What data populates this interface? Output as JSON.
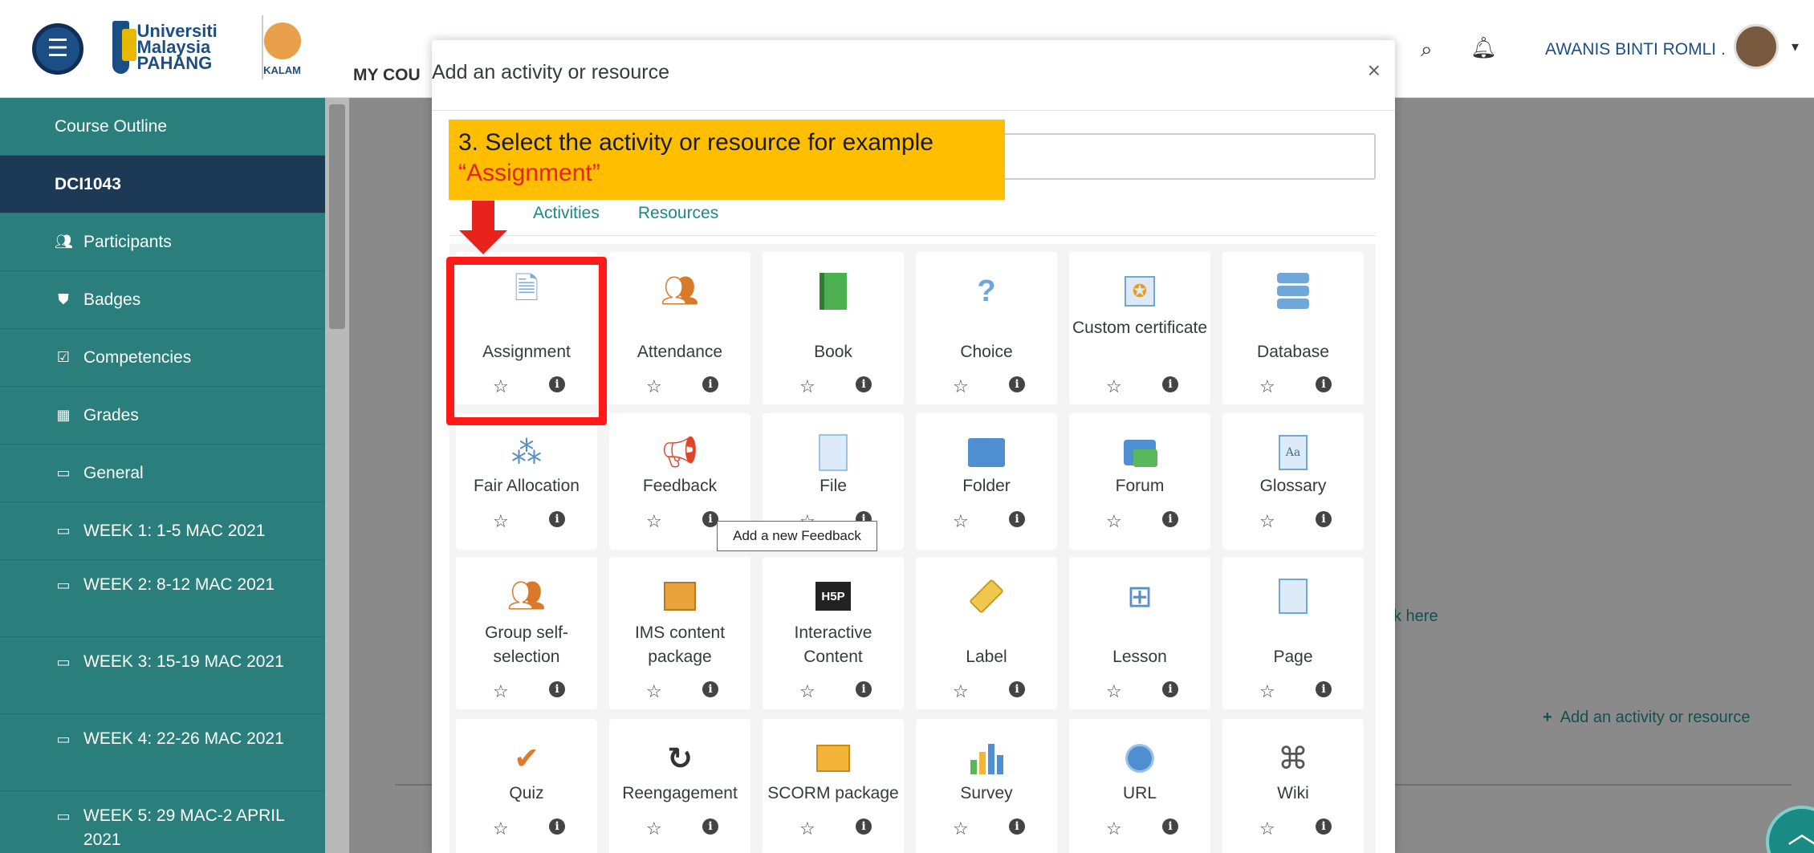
{
  "header": {
    "logo": {
      "text": "Universiti Malaysia PAHANG",
      "kalam": "KALAM"
    },
    "nav_label": "MY COU",
    "user_name": "AWANIS BINTI ROMLI .",
    "icons": [
      "menu-icon",
      "search-icon",
      "bell-icon",
      "chevron-down-icon"
    ]
  },
  "sidebar": {
    "items": [
      {
        "label": "Course Outline",
        "icon": ""
      },
      {
        "label": "DCI1043",
        "icon": "",
        "active": true
      },
      {
        "label": "Participants",
        "icon": "users-icon"
      },
      {
        "label": "Badges",
        "icon": "shield-icon"
      },
      {
        "label": "Competencies",
        "icon": "check-square-icon"
      },
      {
        "label": "Grades",
        "icon": "table-icon"
      },
      {
        "label": "General",
        "icon": "folder-icon"
      },
      {
        "label": "WEEK 1: 1-5 MAC 2021",
        "icon": "folder-icon"
      },
      {
        "label": "WEEK 2: 8-12 MAC 2021",
        "icon": "folder-icon"
      },
      {
        "label": "WEEK 3: 15-19 MAC 2021",
        "icon": "folder-icon"
      },
      {
        "label": "WEEK 4: 22-26 MAC 2021",
        "icon": "folder-icon"
      },
      {
        "label": "WEEK 5: 29 MAC-2 APRIL 2021",
        "icon": "folder-icon"
      }
    ]
  },
  "main": {
    "click_here": "k here",
    "add_activity": "Add an activity or resource"
  },
  "modal": {
    "title": "Add an activity or resource",
    "close": "×",
    "tabs": [
      "",
      "Activities",
      "Resources"
    ],
    "tooltip": "Add a new Feedback",
    "items": [
      {
        "label": "Assignment",
        "icon": "assignment-icon"
      },
      {
        "label": "Attendance",
        "icon": "attendance-icon"
      },
      {
        "label": "Book",
        "icon": "book-icon"
      },
      {
        "label": "Choice",
        "icon": "question-icon"
      },
      {
        "label": "Custom certificate",
        "icon": "certificate-icon"
      },
      {
        "label": "Database",
        "icon": "database-icon"
      },
      {
        "label": "Fair Allocation",
        "icon": "allocation-icon"
      },
      {
        "label": "Feedback",
        "icon": "megaphone-icon"
      },
      {
        "label": "File",
        "icon": "file-icon"
      },
      {
        "label": "Folder",
        "icon": "folder-icon"
      },
      {
        "label": "Forum",
        "icon": "forum-icon"
      },
      {
        "label": "Glossary",
        "icon": "glossary-icon"
      },
      {
        "label": "Group self-selection",
        "icon": "group-icon"
      },
      {
        "label": "IMS content package",
        "icon": "package-icon"
      },
      {
        "label": "Interactive Content",
        "icon": "h5p-icon"
      },
      {
        "label": "Label",
        "icon": "tag-icon"
      },
      {
        "label": "Lesson",
        "icon": "lesson-icon"
      },
      {
        "label": "Page",
        "icon": "page-icon"
      },
      {
        "label": "Quiz",
        "icon": "quiz-icon"
      },
      {
        "label": "Reengagement",
        "icon": "reengagement-icon"
      },
      {
        "label": "SCORM package",
        "icon": "scorm-icon"
      },
      {
        "label": "Survey",
        "icon": "survey-icon"
      },
      {
        "label": "URL",
        "icon": "globe-icon"
      },
      {
        "label": "Wiki",
        "icon": "wiki-icon"
      }
    ]
  },
  "annotation": {
    "text": "3. Select the activity or resource for example ",
    "highlight": "“Assignment”",
    "colors": {
      "box": "#ffbf00",
      "accent": "#e8221c"
    }
  }
}
